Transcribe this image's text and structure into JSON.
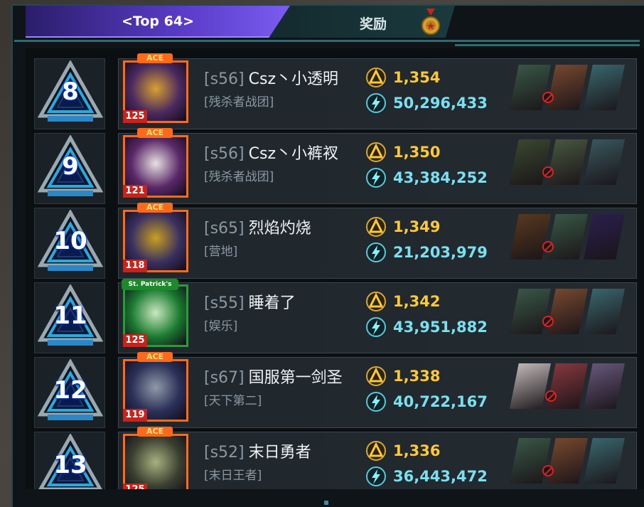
{
  "tabs": {
    "active_label": "<Top 64>",
    "reward_label": "奖励"
  },
  "medal_icon": "medal-icon",
  "colors": {
    "tab_active": "#5a3cc8",
    "trophy_value": "#ffc838",
    "power_value": "#7ae0f0",
    "avatar_border": "#ff6a1a",
    "level_badge": "#c8221a"
  },
  "rows": [
    {
      "rank": "8",
      "server": "[s56]",
      "name": "Csz丶小透明",
      "guild": "[残杀者战团]",
      "trophies": "1,354",
      "power": "50,296,433",
      "level": "125",
      "badge": "ACE",
      "avatar_color": "#4a2a60",
      "avatar_accent": "#d8a030",
      "team": [
        "#3a5a48",
        "#7a4a30",
        "#3a6a70"
      ],
      "ban_slot": 0
    },
    {
      "rank": "9",
      "server": "[s56]",
      "name": "Csz丶小裤衩",
      "guild": "[残杀者战团]",
      "trophies": "1,350",
      "power": "43,384,252",
      "level": "121",
      "badge": "ACE",
      "avatar_color": "#5a2868",
      "avatar_accent": "#e8e0e0",
      "team": [
        "#3a4a30",
        "#4a5a40",
        "#3a5a60"
      ],
      "ban_slot": 0
    },
    {
      "rank": "10",
      "server": "[s65]",
      "name": "烈焰灼烧",
      "guild": "[营地]",
      "trophies": "1,349",
      "power": "21,203,979",
      "level": "118",
      "badge": "ACE",
      "avatar_color": "#3a3060",
      "avatar_accent": "#c8a020",
      "team": [
        "#5a3a20",
        "#3a5a48",
        "#2a2050"
      ],
      "ban_slot": 0
    },
    {
      "rank": "11",
      "server": "[s55]",
      "name": "睡着了",
      "guild": "[娱乐]",
      "trophies": "1,342",
      "power": "43,951,882",
      "level": "125",
      "badge": "St. Patrick's",
      "avatar_color": "#1a7a30",
      "avatar_accent": "#c8e8c0",
      "team": [
        "#3a5a48",
        "#7a4a30",
        "#3a6a70"
      ],
      "ban_slot": 0
    },
    {
      "rank": "12",
      "server": "[s67]",
      "name": "国服第一剑圣",
      "guild": "[天下第二]",
      "trophies": "1,338",
      "power": "40,722,167",
      "level": "119",
      "badge": "ACE",
      "avatar_color": "#2a3058",
      "avatar_accent": "#909aa8",
      "team": [
        "#c8c0c0",
        "#8a3a40",
        "#6a5a80"
      ],
      "ban_slot": 1
    },
    {
      "rank": "13",
      "server": "[s52]",
      "name": "末日勇者",
      "guild": "[末日王者]",
      "trophies": "1,336",
      "power": "36,443,472",
      "level": "125",
      "badge": "ACE",
      "avatar_color": "#3a4030",
      "avatar_accent": "#a8b080",
      "team": [
        "#3a5a48",
        "#7a4a30",
        "#3a6a70"
      ],
      "ban_slot": 0
    }
  ]
}
